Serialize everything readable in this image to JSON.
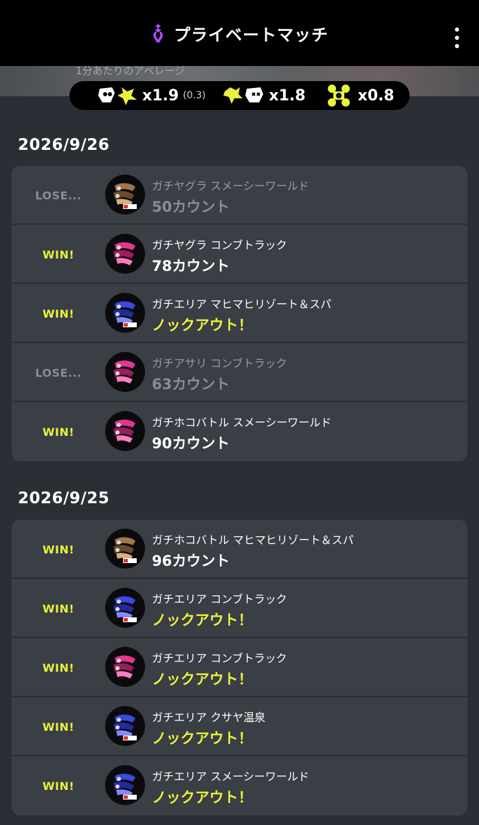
{
  "header": {
    "title": "プライベートマッチ",
    "icon": "squid-icon"
  },
  "average": {
    "label": "1分あたりのアベレージ",
    "kills": {
      "icon": "splat-assist-icon",
      "value": "x1.9",
      "sub": "(0.3)"
    },
    "deaths": {
      "icon": "splatted-icon",
      "value": "x1.8"
    },
    "specials": {
      "icon": "special-icon",
      "value": "x0.8"
    }
  },
  "colors": {
    "win": "#eaf23b",
    "lose": "#8a8d92",
    "card": "#3a3e45",
    "background": "#2b2e34"
  },
  "days": [
    {
      "date": "2026/9/26",
      "matches": [
        {
          "result": "LOSE...",
          "win": false,
          "mode_stage": "ガチヤグラ スメーシーワールド",
          "score": "50カウント",
          "weapon": "bronze"
        },
        {
          "result": "WIN!",
          "win": true,
          "mode_stage": "ガチヤグラ コンブトラック",
          "score": "78カウント",
          "weapon": "pink"
        },
        {
          "result": "WIN!",
          "win": true,
          "mode_stage": "ガチエリア マヒマヒリゾート＆スパ",
          "score": "ノックアウト！",
          "weapon": "blue"
        },
        {
          "result": "LOSE...",
          "win": false,
          "mode_stage": "ガチアサリ コンブトラック",
          "score": "63カウント",
          "weapon": "pink"
        },
        {
          "result": "WIN!",
          "win": true,
          "mode_stage": "ガチホコバトル スメーシーワールド",
          "score": "90カウント",
          "weapon": "pink"
        }
      ]
    },
    {
      "date": "2026/9/25",
      "matches": [
        {
          "result": "WIN!",
          "win": true,
          "mode_stage": "ガチホコバトル マヒマヒリゾート＆スパ",
          "score": "96カウント",
          "weapon": "bronze"
        },
        {
          "result": "WIN!",
          "win": true,
          "mode_stage": "ガチエリア コンブトラック",
          "score": "ノックアウト！",
          "weapon": "blue"
        },
        {
          "result": "WIN!",
          "win": true,
          "mode_stage": "ガチエリア コンブトラック",
          "score": "ノックアウト！",
          "weapon": "pink"
        },
        {
          "result": "WIN!",
          "win": true,
          "mode_stage": "ガチエリア クサヤ温泉",
          "score": "ノックアウト！",
          "weapon": "blue"
        },
        {
          "result": "WIN!",
          "win": true,
          "mode_stage": "ガチエリア スメーシーワールド",
          "score": "ノックアウト！",
          "weapon": "blue"
        }
      ]
    }
  ]
}
